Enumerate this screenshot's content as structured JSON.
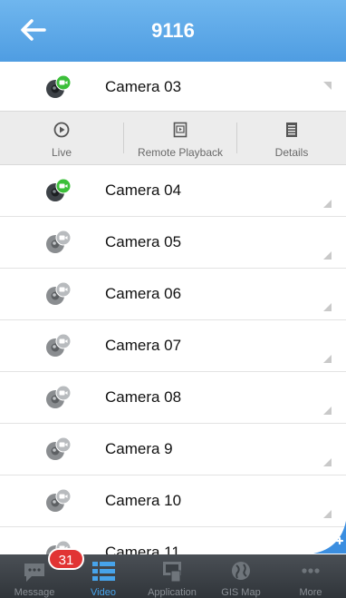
{
  "header": {
    "back_icon": "arrow-left-icon",
    "title": "9116"
  },
  "cameras": [
    {
      "label": "Camera 03",
      "status": "online"
    },
    {
      "label": "Camera 04",
      "status": "online"
    },
    {
      "label": "Camera 05",
      "status": "offline"
    },
    {
      "label": "Camera 06",
      "status": "offline"
    },
    {
      "label": "Camera 07",
      "status": "offline"
    },
    {
      "label": "Camera 08",
      "status": "offline"
    },
    {
      "label": "Camera 9",
      "status": "offline"
    },
    {
      "label": "Camera 10",
      "status": "offline"
    },
    {
      "label": "Camera 11",
      "status": "offline"
    }
  ],
  "actions": {
    "live": "Live",
    "remote_playback": "Remote Playback",
    "details": "Details"
  },
  "tabbar": {
    "message": "Message",
    "video": "Video",
    "application": "Application",
    "gis_map": "GIS Map",
    "more": "More",
    "badge": "31"
  },
  "colors": {
    "header": "#5aa7e8",
    "accent": "#47a3ea",
    "online": "#3cbf3a",
    "badge": "#e13434"
  }
}
